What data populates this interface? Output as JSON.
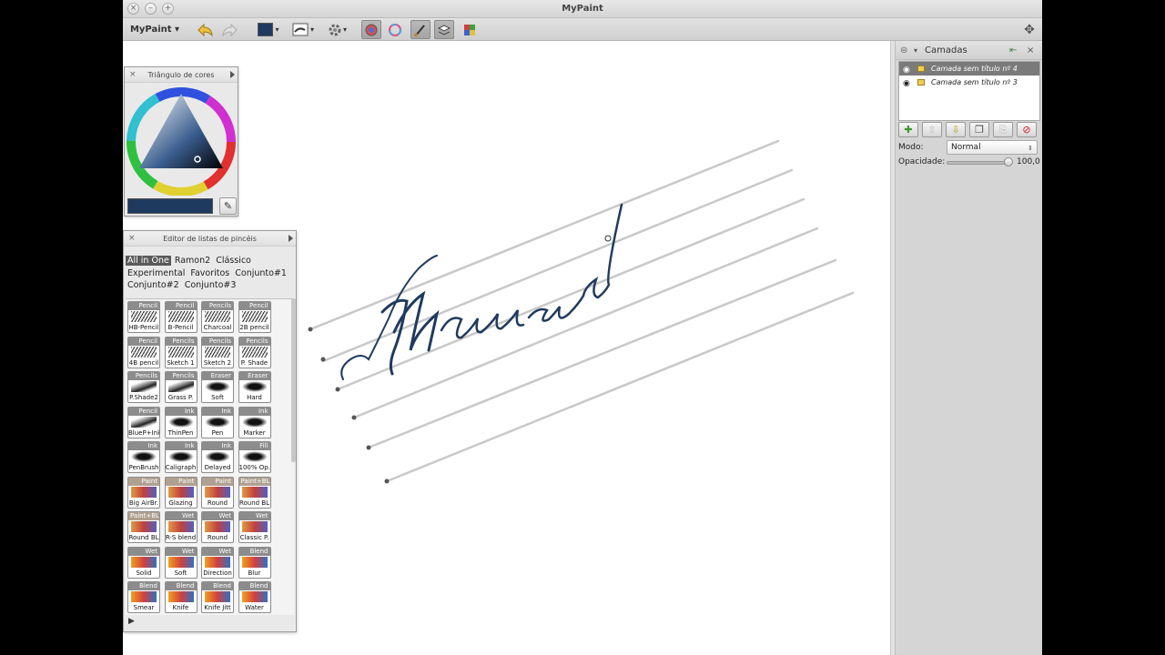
{
  "window": {
    "title": "MyPaint"
  },
  "toolbar": {
    "menu_label": "MyPaint ▾"
  },
  "canvas": {
    "lettering": "Manuscri"
  },
  "color_panel": {
    "title": "Triângulo de cores",
    "current_color": "#1f3a5f"
  },
  "brush_panel": {
    "title": "Editor de listas de pincéis",
    "tabs": [
      "All in One",
      "Ramon2",
      "Clássico",
      "Experimental",
      "Favoritos",
      "Conjunto#1",
      "Conjunto#2",
      "Conjunto#3"
    ],
    "brushes": [
      {
        "cat": "Pencil",
        "name": "HB-Pencil"
      },
      {
        "cat": "Pencil",
        "name": "B-Pencil"
      },
      {
        "cat": "Pencils",
        "name": "Charcoal"
      },
      {
        "cat": "Pencil",
        "name": "2B pencil"
      },
      {
        "cat": "Pencil",
        "name": "4B pencil"
      },
      {
        "cat": "Pencils",
        "name": "Sketch 1"
      },
      {
        "cat": "Pencils",
        "name": "Sketch 2"
      },
      {
        "cat": "Pencils",
        "name": "P. Shade"
      },
      {
        "cat": "Pencils",
        "name": "P.Shade2"
      },
      {
        "cat": "Pencils",
        "name": "Grass P."
      },
      {
        "cat": "Eraser",
        "name": "Soft"
      },
      {
        "cat": "Eraser",
        "name": "Hard"
      },
      {
        "cat": "Pencil",
        "name": "BlueP+Ink"
      },
      {
        "cat": "Ink",
        "name": "ThinPen"
      },
      {
        "cat": "Ink",
        "name": "Pen"
      },
      {
        "cat": "Ink",
        "name": "Marker"
      },
      {
        "cat": "Ink",
        "name": "PenBrush"
      },
      {
        "cat": "Ink",
        "name": "Caligraph"
      },
      {
        "cat": "Ink",
        "name": "Delayed"
      },
      {
        "cat": "Fill",
        "name": "100% Op."
      },
      {
        "cat": "Paint",
        "name": "Big AirBr."
      },
      {
        "cat": "Paint",
        "name": "Glazing"
      },
      {
        "cat": "Paint",
        "name": "Round"
      },
      {
        "cat": "Paint+BL",
        "name": "Round BL"
      },
      {
        "cat": "Paint+BL",
        "name": "Round BL"
      },
      {
        "cat": "Wet",
        "name": "R-S blend"
      },
      {
        "cat": "Wet",
        "name": "Round"
      },
      {
        "cat": "Wet",
        "name": "Classic P."
      },
      {
        "cat": "Wet",
        "name": "Solid"
      },
      {
        "cat": "Wet",
        "name": "Soft"
      },
      {
        "cat": "Wet",
        "name": "Direction"
      },
      {
        "cat": "Blend",
        "name": "Blur"
      },
      {
        "cat": "Blend",
        "name": "Smear"
      },
      {
        "cat": "Blend",
        "name": "Knife"
      },
      {
        "cat": "Blend",
        "name": "Knife Jitt"
      },
      {
        "cat": "Blend",
        "name": "Water"
      }
    ]
  },
  "layers_panel": {
    "title": "Camadas",
    "layers": [
      "Camada sem título nº 4",
      "Camada sem título nº 3"
    ],
    "mode_label": "Modo:",
    "mode_value": "Normal",
    "opacity_label": "Opacidade:",
    "opacity_value": "100,0"
  }
}
